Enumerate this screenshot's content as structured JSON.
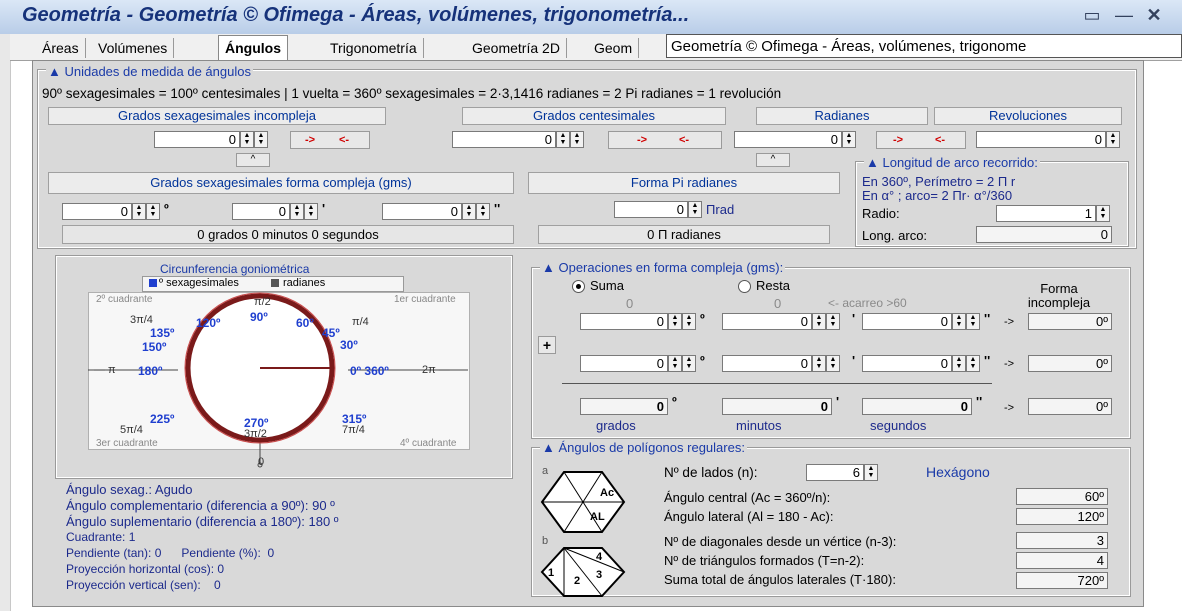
{
  "window": {
    "title": "Geometría - Geometría  © Ofimega - Áreas, volúmenes, trigonometría...",
    "restore_icon": "restore-icon",
    "min_icon": "minimize-icon",
    "close_icon": "close-icon"
  },
  "tabs": [
    {
      "label": "Áreas"
    },
    {
      "label": "Volúmenes"
    },
    {
      "label": "Ángulos",
      "selected": true
    },
    {
      "label": "Trigonometría"
    },
    {
      "label": "Geometría 2D"
    },
    {
      "label": "Geom"
    }
  ],
  "tooltip": "Geometría  © Ofimega - Áreas, volúmenes, trigonome",
  "units": {
    "legend": "▲ Unidades de medida de ángulos",
    "equivalence": "90º sexagesimales = 100º centesimales | 1 vuelta = 360º sexagesimales = 2·3,1416 radianes = 2 Pi radianes = 1 revolución",
    "headers": {
      "sexag": "Grados sexagesimales incompleja",
      "cent": "Grados centesimales",
      "rad": "Radianes",
      "rev": "Revoluciones"
    },
    "values": {
      "sexag": "0",
      "cent": "0",
      "rad": "0",
      "rev": "0"
    },
    "convert_right": "->",
    "convert_left": "<-",
    "expand_label": "^"
  },
  "complex": {
    "header": "Grados sexagesimales forma compleja (gms)",
    "deg": "0",
    "min": "0",
    "sec": "0",
    "deg_sym": "º",
    "min_sym": "'",
    "sec_sym": "''",
    "summary": "0 grados 0 minutos 0 segundos"
  },
  "pi_form": {
    "header": "Forma Pi radianes",
    "value": "0",
    "unit": "Πrad",
    "summary": "0  Π radianes"
  },
  "arc": {
    "legend": "▲ Longitud de arco recorrido:",
    "line1": "En 360º,  Perímetro =  2 Π r",
    "line2": "En  α°   ; arco= 2 Πr· α°/360",
    "radio_label": "Radio:",
    "radio_value": "1",
    "long_label": "Long. arco:",
    "long_value": "0"
  },
  "circle": {
    "title": "Circunferencia goniométrica",
    "legend_sex": "º sexagesimales",
    "legend_rad": "radianes",
    "q2": "2º cuadrante",
    "q1": "1er cuadrante",
    "q3": "3er cuadrante",
    "q4": "4º cuadrante",
    "deg": {
      "d0": "0º 360º",
      "d30": "30º",
      "d45": "45º",
      "d60": "60º",
      "d90": "90º",
      "d120": "120º",
      "d135": "135º",
      "d150": "150º",
      "d180": "180º",
      "d225": "225º",
      "d270": "270º",
      "d315": "315º"
    },
    "rad": {
      "r_pi2": "π/2",
      "r_pi4": "π/4",
      "r_3pi4": "3π/4",
      "r_pi": "— π",
      "r_2pi": "2π —",
      "r_5pi4": "5π/4",
      "r_3pi2": "3π/2",
      "r_7pi4": "7π/4"
    },
    "center_label": "0",
    "bottom_label": "0"
  },
  "info": {
    "l1": "Ángulo sexag.: Agudo",
    "l2": "Ángulo complementario (diferencia a 90º): 90 º",
    "l3": "Ángulo suplementario (diferencia a 180º): 180 º",
    "l4": "Cuadrante: 1",
    "l5": "Pendiente (tan): 0      Pendiente (%):  0",
    "l6": "Proyección horizontal (cos): 0",
    "l7": "Proyección vertical (sen):    0"
  },
  "ops": {
    "legend": "▲ Operaciones en forma compleja (gms):",
    "suma": "Suma",
    "resta": "Resta",
    "carry0a": "0",
    "carry0b": "0",
    "carry_label": "<- acarreo >60",
    "forma": "Forma incompleja",
    "row1": {
      "deg": "0",
      "min": "0",
      "sec": "0",
      "res": "0º"
    },
    "row2": {
      "deg": "0",
      "min": "0",
      "sec": "0",
      "res": "0º"
    },
    "row3": {
      "deg": "0",
      "min": "0",
      "sec": "0",
      "res": "0º"
    },
    "plus": "+",
    "arrow": "->",
    "col_grados": "grados",
    "col_minutos": "minutos",
    "col_segundos": "segundos"
  },
  "poly": {
    "legend": "▲ Ángulos de polígonos regulares:",
    "lados_label": "Nº de lados (n):",
    "lados_value": "6",
    "name": "Hexágono",
    "central_label": "Ángulo central (Ac = 360º/n):",
    "central_value": "60º",
    "lateral_label": "Ángulo lateral (Al = 180 - Ac):",
    "lateral_value": "120º",
    "diag_label": "Nº de diagonales desde un vértice (n-3):",
    "diag_value": "3",
    "tri_label": "Nº de triángulos formados (T=n-2):",
    "tri_value": "4",
    "sum_label": "Suma total de ángulos laterales (T·180):",
    "sum_value": "720º",
    "img_a": "a",
    "img_b": "b",
    "ac": "Ac",
    "al": "AL",
    "n1": "1",
    "n2": "2",
    "n3": "3",
    "n4": "4"
  }
}
